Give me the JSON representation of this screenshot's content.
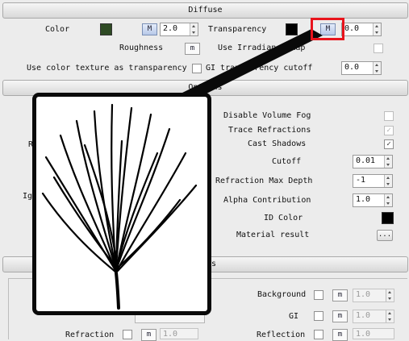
{
  "sections": {
    "diffuse": "Diffuse",
    "options": "Options",
    "lower_partial": "s"
  },
  "diffuse": {
    "color_label": "Color",
    "color_swatch": "#2e4a24",
    "color_map_btn": "M",
    "color_value": "2.0",
    "transparency_label": "Transparency",
    "transparency_swatch": "#000000",
    "transparency_map_btn": "M",
    "transparency_value": "0.0",
    "roughness_label": "Roughness",
    "roughness_btn": "m",
    "use_irradiance_label": "Use Irradiance Map",
    "use_color_texture_label": "Use color texture as transparency",
    "gi_transparency_label": "GI transparency cutoff",
    "gi_transparency_value": "0.0"
  },
  "options": {
    "disable_volume_fog": "Disable Volume Fog",
    "trace_refractions": "Trace Refractions",
    "trace_refractions_check": "✓",
    "cast_shadows": "Cast Shadows",
    "cast_shadows_check": "✓",
    "cutoff_label": "Cutoff",
    "cutoff_value": "0.01",
    "refraction_max_depth_label": "Refraction Max Depth",
    "refraction_max_depth_value": "-1",
    "alpha_contribution_label": "Alpha Contribution",
    "alpha_contribution_value": "1.0",
    "id_color_label": "ID Color",
    "id_color_swatch": "#000000",
    "material_result_label": "Material result",
    "material_result_btn": "...",
    "left_partial_r": "R",
    "left_partial_ig": "Ig"
  },
  "lower": {
    "background_label": "Background",
    "background_btn": "m",
    "background_value": "1.0",
    "gi_label": "GI",
    "gi_btn": "m",
    "gi_value": "1.0",
    "refraction_label": "Refraction",
    "refraction_btn": "m",
    "refraction_value": "1.0",
    "reflection_label": "Reflection",
    "reflection_btn": "m",
    "reflection_value": "1.0"
  },
  "colors": {
    "highlight": "#e8141c",
    "callout": "#0a0a0a"
  }
}
